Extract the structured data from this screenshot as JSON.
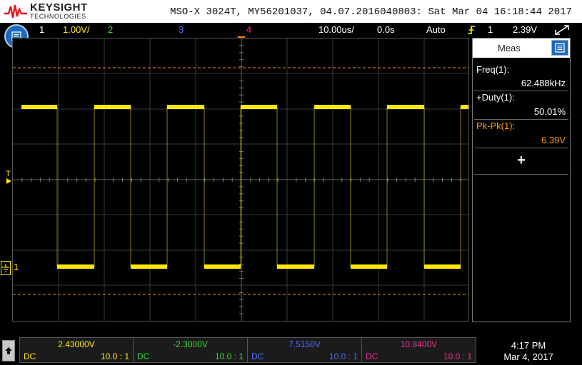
{
  "brand": {
    "name": "KEYSIGHT",
    "subtitle": "TECHNOLOGIES"
  },
  "header": {
    "title": "MSO-X 3024T, MY56201037, 04.07.2016040803: Sat Mar 04 16:18:44 2017"
  },
  "status": {
    "ch1_num": "1",
    "ch1_scale": "1.00V/",
    "ch2_num": "2",
    "ch3_num": "3",
    "ch4_num": "4",
    "timebase": "10.00us/",
    "delay": "0.0s",
    "trigger_mode": "Auto",
    "trigger_source": "1",
    "trigger_level": "2.39V"
  },
  "measurements": {
    "title": "Meas",
    "items": [
      {
        "label": "Freq(1):",
        "value": "62.488kHz"
      },
      {
        "label": "+Duty(1):",
        "value": "50.01%"
      },
      {
        "label": "Pk-Pk(1):",
        "value": "6.39V"
      }
    ],
    "add_symbol": "+"
  },
  "markers": {
    "trigger_label": "T",
    "ch1_ground_label": "1"
  },
  "channels": [
    {
      "offset": "2.43000V",
      "coupling": "DC",
      "probe": "10.0 : 1",
      "color": "#ffe800"
    },
    {
      "offset": "-2.3000V",
      "coupling": "DC",
      "probe": "10.0 : 1",
      "color": "#33dd33"
    },
    {
      "offset": "7.5150V",
      "coupling": "DC",
      "probe": "10.0 : 1",
      "color": "#4a6fff"
    },
    {
      "offset": "10.8400V",
      "coupling": "DC",
      "probe": "10.0 : 1",
      "color": "#ee3399"
    }
  ],
  "clock": {
    "time": "4:17 PM",
    "date": "Mar 4, 2017"
  },
  "colors": {
    "ch1": "#ffe800",
    "ch2": "#33dd33",
    "ch3": "#4a6fff",
    "ch4": "#ee3399",
    "trigger_marker": "#ff8800",
    "cursor_line": "#ff8800",
    "grid": "#3a3a3a"
  },
  "icons": {
    "menu": "menu-list-icon",
    "pan": "trigger-edge-icon",
    "touch": "touch-gesture-icon",
    "up": "up-arrow-icon"
  }
}
